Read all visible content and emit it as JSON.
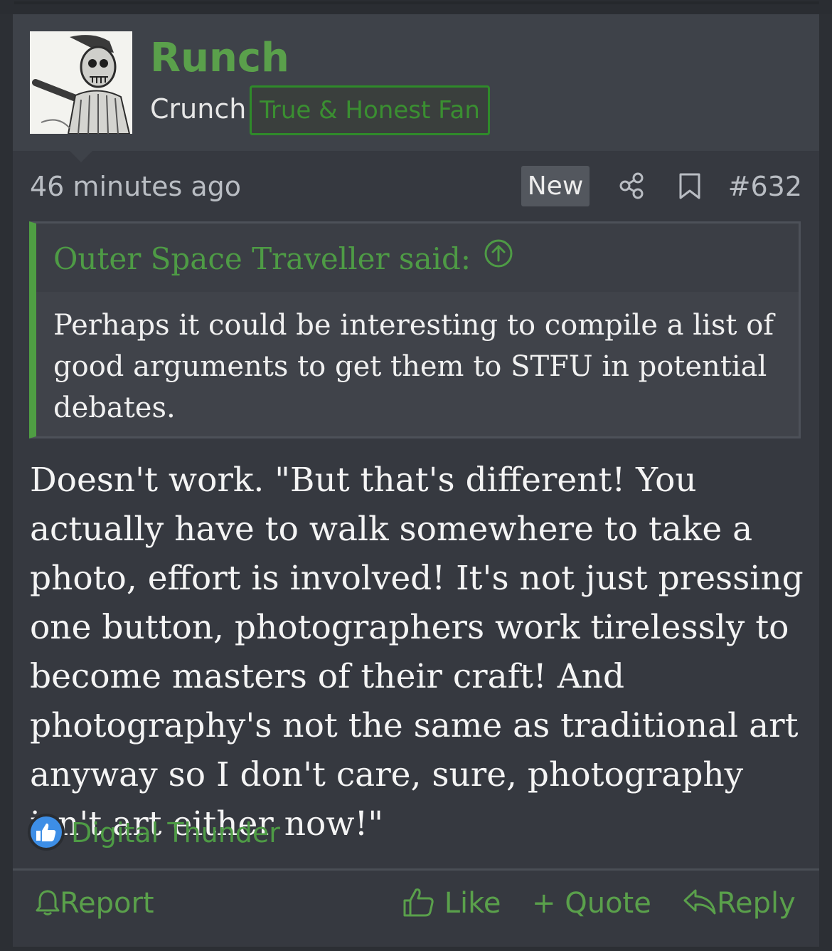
{
  "user": {
    "username": "Runch",
    "title": "Crunch",
    "banner": "True & Honest Fan"
  },
  "meta": {
    "time": "46 minutes ago",
    "new_label": "New",
    "post_number": "#632"
  },
  "quote": {
    "author_line": "Outer Space Traveller said:",
    "text": "Perhaps it could be interesting to compile a list of good arguments to get them to STFU in potential debates."
  },
  "message": "Doesn't work. \"But that's different! You actually have to walk somewhere to take a photo, effort is involved! It's not just pressing one button, photographers work tirelessly to become masters of their craft! And photography's not the same as traditional art anyway so I don't care, sure, photography isn't art either now!\"",
  "reactions": {
    "users": "Digital Thunder"
  },
  "actions": {
    "report": "Report",
    "like": "Like",
    "quote": "+ Quote",
    "reply": "Reply"
  },
  "colors": {
    "accent_green": "#5aa04b",
    "quote_border": "#4f9e43",
    "like_blue": "#3d8ee6"
  },
  "icons": [
    "user-avatar",
    "share-icon",
    "bookmark-icon",
    "up-arrow-icon",
    "like-reaction-icon",
    "bell-icon",
    "thumbs-up-icon",
    "reply-arrow-icon"
  ]
}
